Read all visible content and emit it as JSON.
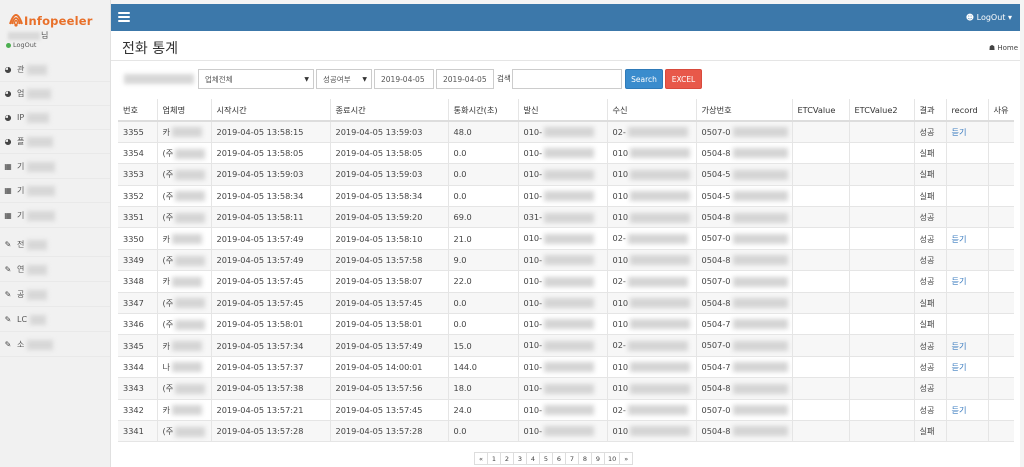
{
  "brand": {
    "logo_text": "Infopeeler"
  },
  "user": {
    "suffix": "님",
    "logout_label": "LogOut"
  },
  "sidebar": {
    "items": [
      {
        "icon": "dashboard-icon",
        "glyph": "◕",
        "label": "관"
      },
      {
        "icon": "dashboard-icon",
        "glyph": "◕",
        "label": "업"
      },
      {
        "icon": "dashboard-icon",
        "glyph": "◕",
        "label": "IP"
      },
      {
        "icon": "dashboard-icon",
        "glyph": "◕",
        "label": "플"
      },
      {
        "icon": "grid-icon",
        "glyph": "▦",
        "label": "기"
      },
      {
        "icon": "grid-icon",
        "glyph": "▦",
        "label": "기"
      },
      {
        "icon": "grid-icon",
        "glyph": "▦",
        "label": "기"
      },
      {
        "icon": "edit-icon",
        "glyph": "✎",
        "label": "전"
      },
      {
        "icon": "edit-icon",
        "glyph": "✎",
        "label": "연"
      },
      {
        "icon": "edit-icon",
        "glyph": "✎",
        "label": "공"
      },
      {
        "icon": "edit-icon",
        "glyph": "✎",
        "label": "LC"
      },
      {
        "icon": "edit-icon",
        "glyph": "✎",
        "label": "소"
      }
    ]
  },
  "topbar": {
    "logout_label": "LogOut ▾",
    "user_glyph": "👤"
  },
  "page": {
    "title": "전화 통계",
    "breadcrumb": "Home"
  },
  "filters": {
    "company_select": "업체전체",
    "result_select": "성공여부",
    "date_from": "2019-04-05",
    "date_to": "2019-04-05",
    "search_label": "검색",
    "search_value": "",
    "search_button": "Search",
    "excel_button": "EXCEL"
  },
  "table": {
    "headers": [
      "번호",
      "업체명",
      "시작시간",
      "종료시간",
      "통화시간(초)",
      "발신",
      "수신",
      "가상번호",
      "ETCValue",
      "ETCValue2",
      "결과",
      "record",
      "사유"
    ],
    "rows": [
      {
        "no": "3355",
        "co": "카",
        "start": "2019-04-05 13:58:15",
        "end": "2019-04-05 13:59:03",
        "dur": "48.0",
        "from": "010-",
        "to": "02-",
        "virt": "0507-0",
        "result": "성공",
        "record": "듣기"
      },
      {
        "no": "3354",
        "co": "(주",
        "start": "2019-04-05 13:58:05",
        "end": "2019-04-05 13:58:05",
        "dur": "0.0",
        "from": "010-",
        "to": "010",
        "virt": "0504-8",
        "result": "실패",
        "record": ""
      },
      {
        "no": "3353",
        "co": "(주",
        "start": "2019-04-05 13:59:03",
        "end": "2019-04-05 13:59:03",
        "dur": "0.0",
        "from": "010-",
        "to": "010",
        "virt": "0504-5",
        "result": "실패",
        "record": ""
      },
      {
        "no": "3352",
        "co": "(주",
        "start": "2019-04-05 13:58:34",
        "end": "2019-04-05 13:58:34",
        "dur": "0.0",
        "from": "010-",
        "to": "010",
        "virt": "0504-5",
        "result": "실패",
        "record": ""
      },
      {
        "no": "3351",
        "co": "(주",
        "start": "2019-04-05 13:58:11",
        "end": "2019-04-05 13:59:20",
        "dur": "69.0",
        "from": "031-",
        "to": "010",
        "virt": "0504-8",
        "result": "성공",
        "record": ""
      },
      {
        "no": "3350",
        "co": "카",
        "start": "2019-04-05 13:57:49",
        "end": "2019-04-05 13:58:10",
        "dur": "21.0",
        "from": "010-",
        "to": "02-",
        "virt": "0507-0",
        "result": "성공",
        "record": "듣기"
      },
      {
        "no": "3349",
        "co": "(주",
        "start": "2019-04-05 13:57:49",
        "end": "2019-04-05 13:57:58",
        "dur": "9.0",
        "from": "010-",
        "to": "010",
        "virt": "0504-8",
        "result": "성공",
        "record": ""
      },
      {
        "no": "3348",
        "co": "카",
        "start": "2019-04-05 13:57:45",
        "end": "2019-04-05 13:58:07",
        "dur": "22.0",
        "from": "010-",
        "to": "02-",
        "virt": "0507-0",
        "result": "성공",
        "record": "듣기"
      },
      {
        "no": "3347",
        "co": "(주",
        "start": "2019-04-05 13:57:45",
        "end": "2019-04-05 13:57:45",
        "dur": "0.0",
        "from": "010-",
        "to": "010",
        "virt": "0504-8",
        "result": "실패",
        "record": ""
      },
      {
        "no": "3346",
        "co": "(주",
        "start": "2019-04-05 13:58:01",
        "end": "2019-04-05 13:58:01",
        "dur": "0.0",
        "from": "010-",
        "to": "010",
        "virt": "0504-7",
        "result": "실패",
        "record": ""
      },
      {
        "no": "3345",
        "co": "카",
        "start": "2019-04-05 13:57:34",
        "end": "2019-04-05 13:57:49",
        "dur": "15.0",
        "from": "010-",
        "to": "02-",
        "virt": "0507-0",
        "result": "성공",
        "record": "듣기"
      },
      {
        "no": "3344",
        "co": "나",
        "start": "2019-04-05 13:57:37",
        "end": "2019-04-05 14:00:01",
        "dur": "144.0",
        "from": "010-",
        "to": "010",
        "virt": "0504-7",
        "result": "성공",
        "record": "듣기"
      },
      {
        "no": "3343",
        "co": "(주",
        "start": "2019-04-05 13:57:38",
        "end": "2019-04-05 13:57:56",
        "dur": "18.0",
        "from": "010-",
        "to": "010",
        "virt": "0504-8",
        "result": "성공",
        "record": ""
      },
      {
        "no": "3342",
        "co": "카",
        "start": "2019-04-05 13:57:21",
        "end": "2019-04-05 13:57:45",
        "dur": "24.0",
        "from": "010-",
        "to": "02-",
        "virt": "0507-0",
        "result": "성공",
        "record": "듣기"
      },
      {
        "no": "3341",
        "co": "(주",
        "start": "2019-04-05 13:57:28",
        "end": "2019-04-05 13:57:28",
        "dur": "0.0",
        "from": "010-",
        "to": "010",
        "virt": "0504-8",
        "result": "실패",
        "record": ""
      }
    ]
  },
  "pagination": {
    "items": [
      "«",
      "1",
      "2",
      "3",
      "4",
      "5",
      "6",
      "7",
      "8",
      "9",
      "10",
      "»"
    ]
  },
  "colors": {
    "topbar": "#3c78aa",
    "search": "#3a8ccd",
    "excel": "#e8584a",
    "link": "#3a7bbf",
    "brand": "#e8702a"
  }
}
